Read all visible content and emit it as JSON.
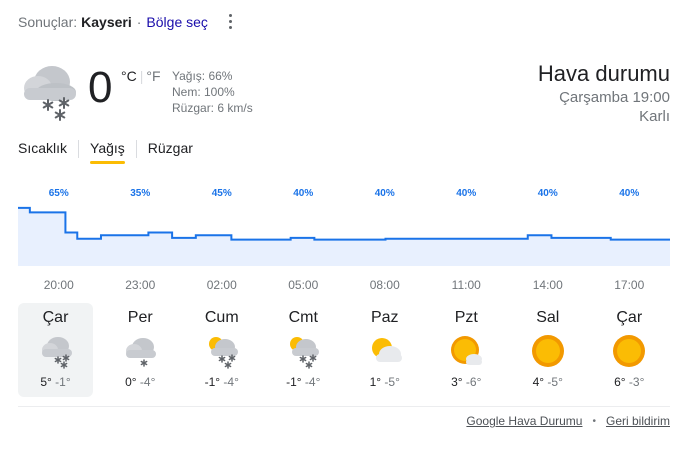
{
  "header": {
    "results_label": "Sonuçlar:",
    "location": "Kayseri",
    "separator": "·",
    "region_link": "Bölge seç",
    "more_icon": "more-vert-icon"
  },
  "current": {
    "icon": "snow-cloud-icon",
    "temperature": "0",
    "unit_c": "°C",
    "unit_sep": "|",
    "unit_f": "°F",
    "precipitation": "Yağış: 66%",
    "humidity": "Nem: 100%",
    "wind": "Rüzgar: 6 km/s"
  },
  "summary": {
    "title": "Hava durumu",
    "datetime": "Çarşamba 19:00",
    "condition": "Karlı"
  },
  "tabs": [
    {
      "label": "Sıcaklık",
      "active": false
    },
    {
      "label": "Yağış",
      "active": true
    },
    {
      "label": "Rüzgar",
      "active": false
    }
  ],
  "chart_data": {
    "type": "area",
    "title": "",
    "xlabel": "",
    "ylabel": "",
    "ylim": [
      0,
      100
    ],
    "x": [
      "20:00",
      "23:00",
      "02:00",
      "05:00",
      "08:00",
      "11:00",
      "14:00",
      "17:00"
    ],
    "series": [
      {
        "values": [
          65,
          35,
          45,
          40,
          40,
          40,
          40,
          40
        ]
      }
    ],
    "labels": [
      "65%",
      "35%",
      "45%",
      "40%",
      "40%",
      "40%",
      "40%",
      "40%"
    ],
    "hourly_steps": [
      66,
      61,
      61,
      61,
      38,
      31,
      31,
      35,
      35,
      35,
      35,
      38,
      38,
      32,
      32,
      35,
      35,
      35,
      30,
      30,
      30,
      30,
      30,
      32,
      32,
      30,
      30,
      30,
      30,
      30,
      30,
      31,
      31,
      31,
      31,
      31,
      31,
      31,
      31,
      31,
      31,
      31,
      31,
      35,
      35,
      32,
      32,
      32,
      32,
      32,
      30,
      30,
      30,
      30,
      30
    ],
    "line_color": "#1a73e8",
    "fill_color": "#e8f0fe",
    "label_color": "#1a73e8"
  },
  "days": [
    {
      "name": "Çar",
      "icon": "snow-cloud-icon",
      "high": "5°",
      "low": "-1°",
      "selected": true
    },
    {
      "name": "Per",
      "icon": "snow-light-cloud-icon",
      "high": "0°",
      "low": "-4°",
      "selected": false
    },
    {
      "name": "Cum",
      "icon": "snow-sun-cloud-icon",
      "high": "-1°",
      "low": "-4°",
      "selected": false
    },
    {
      "name": "Cmt",
      "icon": "snow-sun-cloud-icon",
      "high": "-1°",
      "low": "-4°",
      "selected": false
    },
    {
      "name": "Paz",
      "icon": "partly-cloudy-icon",
      "high": "1°",
      "low": "-5°",
      "selected": false
    },
    {
      "name": "Pzt",
      "icon": "mostly-sunny-icon",
      "high": "3°",
      "low": "-6°",
      "selected": false
    },
    {
      "name": "Sal",
      "icon": "sunny-icon",
      "high": "4°",
      "low": "-5°",
      "selected": false
    },
    {
      "name": "Çar",
      "icon": "sunny-icon",
      "high": "6°",
      "low": "-3°",
      "selected": false
    }
  ],
  "footer": {
    "source_link": "Google Hava Durumu",
    "bullet": "•",
    "feedback_link": "Geri bildirim"
  }
}
